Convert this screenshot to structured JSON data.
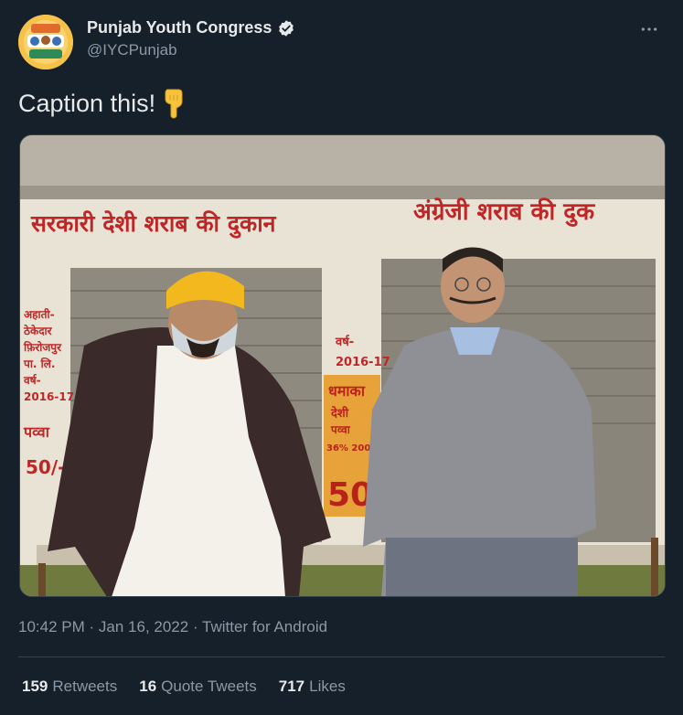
{
  "author": {
    "display_name": "Punjab Youth Congress",
    "handle": "@IYCPunjab",
    "verified": true,
    "avatar_icon": "party-logo-avatar"
  },
  "more_icon": "more-options-icon",
  "tweet": {
    "text": "Caption this!",
    "emoji": "backhand-index-pointing-down"
  },
  "media": {
    "sign_left": "सरकारी देशी शराब की दुकान",
    "sign_right": "अंग्रेजी शराब की दुक",
    "wall_left_note": [
      "अहाती-",
      "ठेकेदार",
      "फ़िरोजपुर",
      "पा. लि.",
      "वर्ष-",
      "2016-17",
      "पव्वा",
      "50/-"
    ],
    "wall_mid_year": [
      "वर्ष-",
      "2016-17"
    ],
    "poster": [
      "धमाका",
      "देशी",
      "पव्वा",
      "36% 200",
      "50"
    ]
  },
  "meta": {
    "time": "10:42 PM",
    "separator": "·",
    "date": "Jan 16, 2022",
    "source": "Twitter for Android"
  },
  "stats": [
    {
      "count": "159",
      "label": "Retweets"
    },
    {
      "count": "16",
      "label": "Quote Tweets"
    },
    {
      "count": "717",
      "label": "Likes"
    }
  ],
  "colors": {
    "background": "#15202b",
    "primary_text": "#e7e9ea",
    "secondary_text": "#8b98a5",
    "verified_badge": "#e7e9ea",
    "divider": "#38444d"
  }
}
